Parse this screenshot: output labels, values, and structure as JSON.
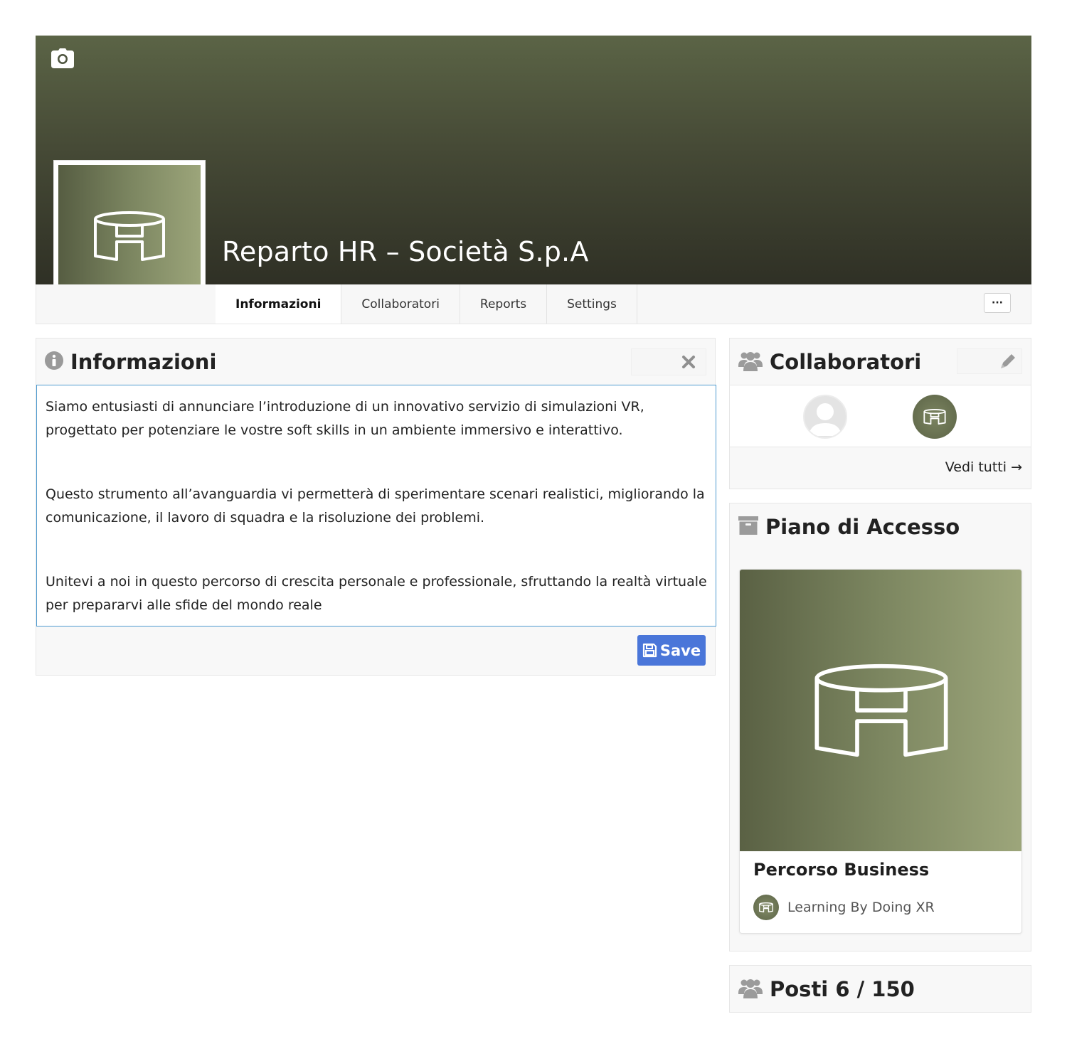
{
  "header": {
    "title": "Reparto HR – Società S.p.A"
  },
  "nav": {
    "tabs": [
      {
        "label": "Informazioni",
        "active": true
      },
      {
        "label": "Collaboratori",
        "active": false
      },
      {
        "label": "Reports",
        "active": false
      },
      {
        "label": "Settings",
        "active": false
      }
    ],
    "more_label": "···"
  },
  "info": {
    "title": "Informazioni",
    "paragraphs": [
      "Siamo entusiasti di annunciare l’introduzione di un innovativo servizio di simulazioni VR, progettato per potenziare le vostre soft skills in un ambiente immersivo e interattivo.",
      "Questo strumento all’avanguardia vi permetterà di sperimentare scenari realistici, migliorando la comunicazione, il lavoro di squadra e la risoluzione dei problemi.",
      "Unitevi a noi in questo percorso di crescita personale e professionale, sfruttando la realtà virtuale per prepararvi alle sfide del mondo reale"
    ],
    "save_label": "Save"
  },
  "collaborators": {
    "title": "Collaboratori",
    "see_all": "Vedi tutti →"
  },
  "plan": {
    "title": "Piano di Accesso",
    "card_name": "Percorso Business",
    "org_name": "Learning By Doing XR"
  },
  "seats": {
    "title": "Posti 6 / 150"
  },
  "icons": {
    "cover": "camera-icon",
    "info": "info-circle-icon",
    "close": "close-icon",
    "collab": "users-icon",
    "edit": "pencil-icon",
    "plan": "archive-icon",
    "save": "floppy-disk-icon",
    "logo": "vr-headset-logo"
  },
  "colors": {
    "accent": "#4a76d9",
    "brand_olive": "#7b8560",
    "editor_border": "#4f9bd0"
  }
}
